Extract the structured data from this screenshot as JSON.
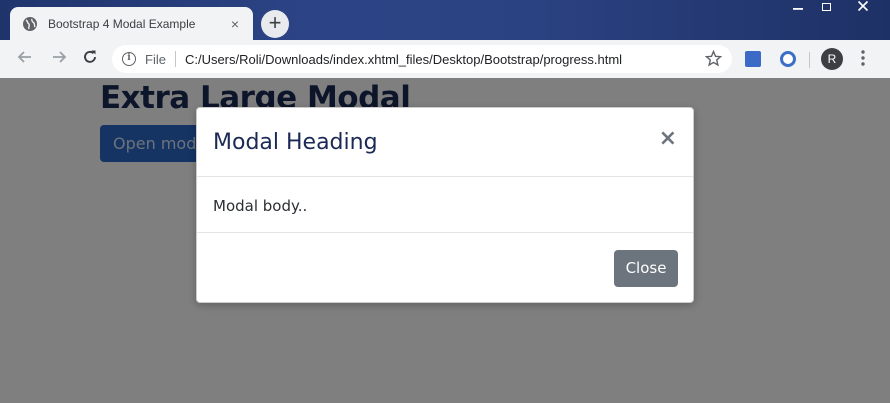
{
  "browser": {
    "tab_title": "Bootstrap 4 Modal Example",
    "tab_close": "×",
    "new_tab": "+",
    "scheme_label": "File",
    "url": "C:/Users/Roli/Downloads/index.xhtml_files/Desktop/Bootstrap/progress.html",
    "avatar_initial": "R"
  },
  "page": {
    "heading": "Extra Large Modal",
    "open_button": "Open modal"
  },
  "modal": {
    "title": "Modal Heading",
    "close_icon": "×",
    "body": "Modal body..",
    "close_button": "Close"
  },
  "colors": {
    "accent": "#2a66c7",
    "secondary_button": "#6c757d",
    "heading_text": "#1b2a55"
  }
}
